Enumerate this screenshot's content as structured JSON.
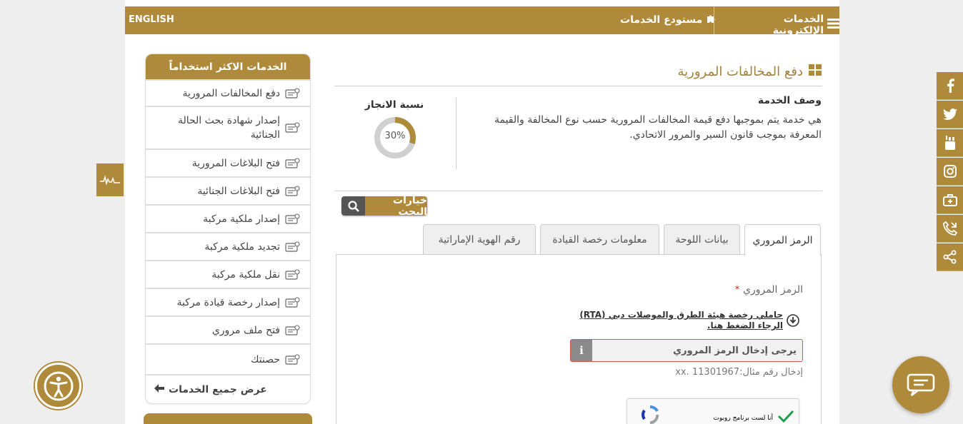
{
  "topbar": {
    "language": "ENGLISH",
    "eservices": "الخدمات الإلكترونية",
    "repository": "مستودع الخدمات"
  },
  "sidebar": {
    "title": "الخدمات الاكثر استخداماً",
    "items": [
      {
        "label": "دفع المخالفات المرورية",
        "icon": "fines-icon"
      },
      {
        "label": "إصدار شهادة بحث الحالة الجنائية",
        "icon": "certificate-icon"
      },
      {
        "label": "فتح البلاغات المرورية",
        "icon": "traffic-report-icon"
      },
      {
        "label": "فتح البلاغات الجنائية",
        "icon": "criminal-report-icon"
      },
      {
        "label": "إصدار ملكية مركبة",
        "icon": "vehicle-ownership-icon"
      },
      {
        "label": "تجديد ملكية مركبة",
        "icon": "renew-ownership-icon"
      },
      {
        "label": "نقل ملكية مركبة",
        "icon": "transfer-ownership-icon"
      },
      {
        "label": "إصدار رخصة قيادة مركبة",
        "icon": "driving-license-icon"
      },
      {
        "label": "فتح ملف مروري",
        "icon": "traffic-file-icon"
      },
      {
        "label": "حصنتك",
        "icon": "hasantak-icon"
      }
    ],
    "all_services": "عرض جميع الخدمات"
  },
  "main": {
    "title": "دفع المخالفات المرورية",
    "desc_head": "وصف الخدمة",
    "desc_text": "هي خدمة يتم بموجبها دفع قيمة المخالفات المرورية حسب نوع المخالفة والقيمة المعرفة بموجب قانون السير والمرور الاتحادي.",
    "progress_label": "نسبة الانجاز",
    "progress_value": "30%",
    "progress_fraction": 0.3,
    "search_options": "خيارات البحث",
    "tabs": [
      "الرمز المروري",
      "بيانات اللوحة",
      "معلومات رخصة القيادة",
      "رقم الهوية الإماراتية"
    ],
    "field_label": "الرمز المروري",
    "required_mark": "*",
    "rta_note": "حاملي رخصة هيئة الطرق والموصلات دبي (RTA) الرجاء الضغط هنا.",
    "input_placeholder": "يرجى إدخال الرمز المروري",
    "info_symbol": "i",
    "hint": "إدخال رقم مثال:11301967 .xx",
    "captcha_text": "أنا لست برنامج روبوت"
  },
  "social": [
    "facebook-icon",
    "twitter-icon",
    "youtube-icon",
    "instagram-icon",
    "briefcase-icon",
    "phone-icon",
    "share-icon"
  ],
  "colors": {
    "accent": "#b08a3b",
    "error": "#d9534f"
  }
}
